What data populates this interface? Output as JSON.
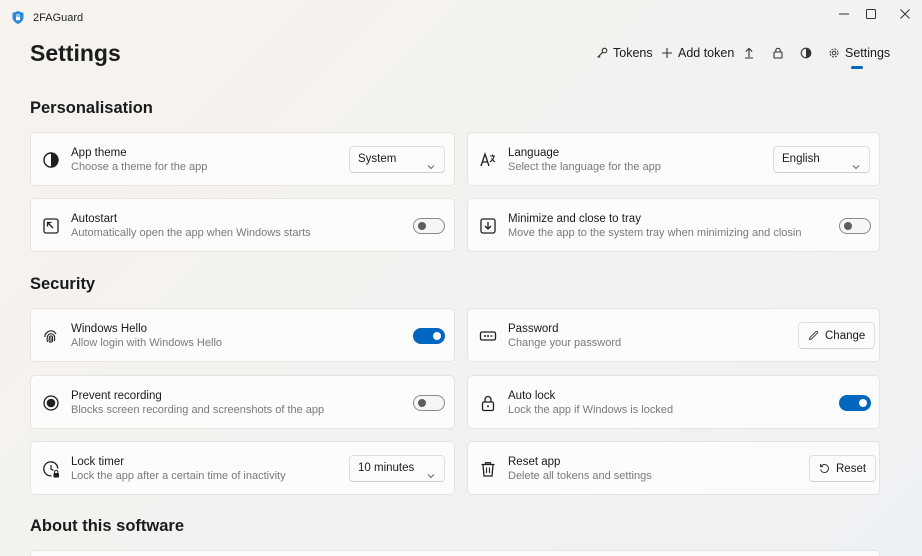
{
  "app": {
    "name": "2FAGuard"
  },
  "page": {
    "title": "Settings"
  },
  "nav": {
    "tokens": "Tokens",
    "add_token": "Add token",
    "settings": "Settings"
  },
  "sections": {
    "personalisation": "Personalisation",
    "security": "Security",
    "about": "About this software"
  },
  "settings": {
    "app_theme": {
      "title": "App theme",
      "subtitle": "Choose a theme for the app",
      "value": "System"
    },
    "language": {
      "title": "Language",
      "subtitle": "Select the language for the app",
      "value": "English"
    },
    "autostart": {
      "title": "Autostart",
      "subtitle": "Automatically open the app when Windows starts",
      "enabled": false
    },
    "minimize_tray": {
      "title": "Minimize and close to tray",
      "subtitle": "Move the app to the system tray when minimizing and closing",
      "enabled": false
    },
    "windows_hello": {
      "title": "Windows Hello",
      "subtitle": "Allow login with Windows Hello",
      "enabled": true
    },
    "password": {
      "title": "Password",
      "subtitle": "Change your password",
      "button": "Change"
    },
    "prevent_recording": {
      "title": "Prevent recording",
      "subtitle": "Blocks screen recording and screenshots of the app",
      "enabled": false
    },
    "auto_lock": {
      "title": "Auto lock",
      "subtitle": "Lock the app if Windows is locked",
      "enabled": true
    },
    "lock_timer": {
      "title": "Lock timer",
      "subtitle": "Lock the app after a certain time of inactivity",
      "value": "10 minutes"
    },
    "reset_app": {
      "title": "Reset app",
      "subtitle": "Delete all tokens and settings",
      "button": "Reset"
    }
  },
  "colors": {
    "accent": "#0067c0"
  }
}
